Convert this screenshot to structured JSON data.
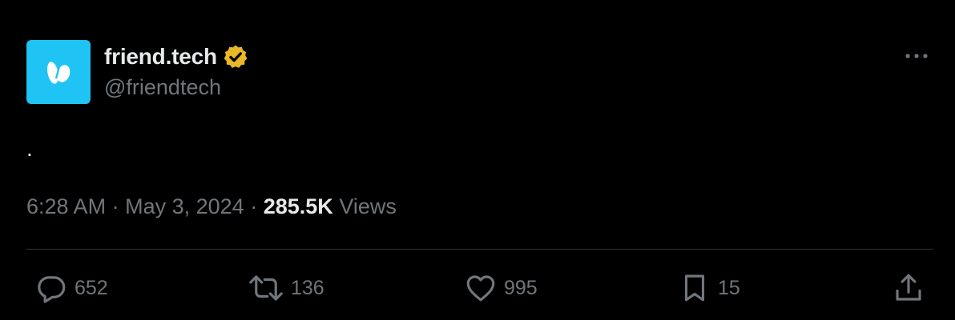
{
  "account": {
    "display_name": "friend.tech",
    "handle": "@friendtech",
    "verified": true,
    "avatar_color": "#1fc3f4",
    "verified_color": "#e8b829"
  },
  "tweet": {
    "text": ".",
    "time": "6:28 AM",
    "date": "May 3, 2024",
    "separator": "·",
    "views_count": "285.5K",
    "views_label": "Views"
  },
  "actions": {
    "replies": "652",
    "reposts": "136",
    "likes": "995",
    "bookmarks": "15"
  },
  "icons": [
    "friendtech-logo-icon",
    "verified-badge-icon",
    "more-icon",
    "reply-icon",
    "repost-icon",
    "like-icon",
    "bookmark-icon",
    "share-icon"
  ],
  "colors": {
    "background": "#000000",
    "primary_text": "#e7e9ea",
    "secondary_text": "#71767b",
    "divider": "#2f3336"
  }
}
